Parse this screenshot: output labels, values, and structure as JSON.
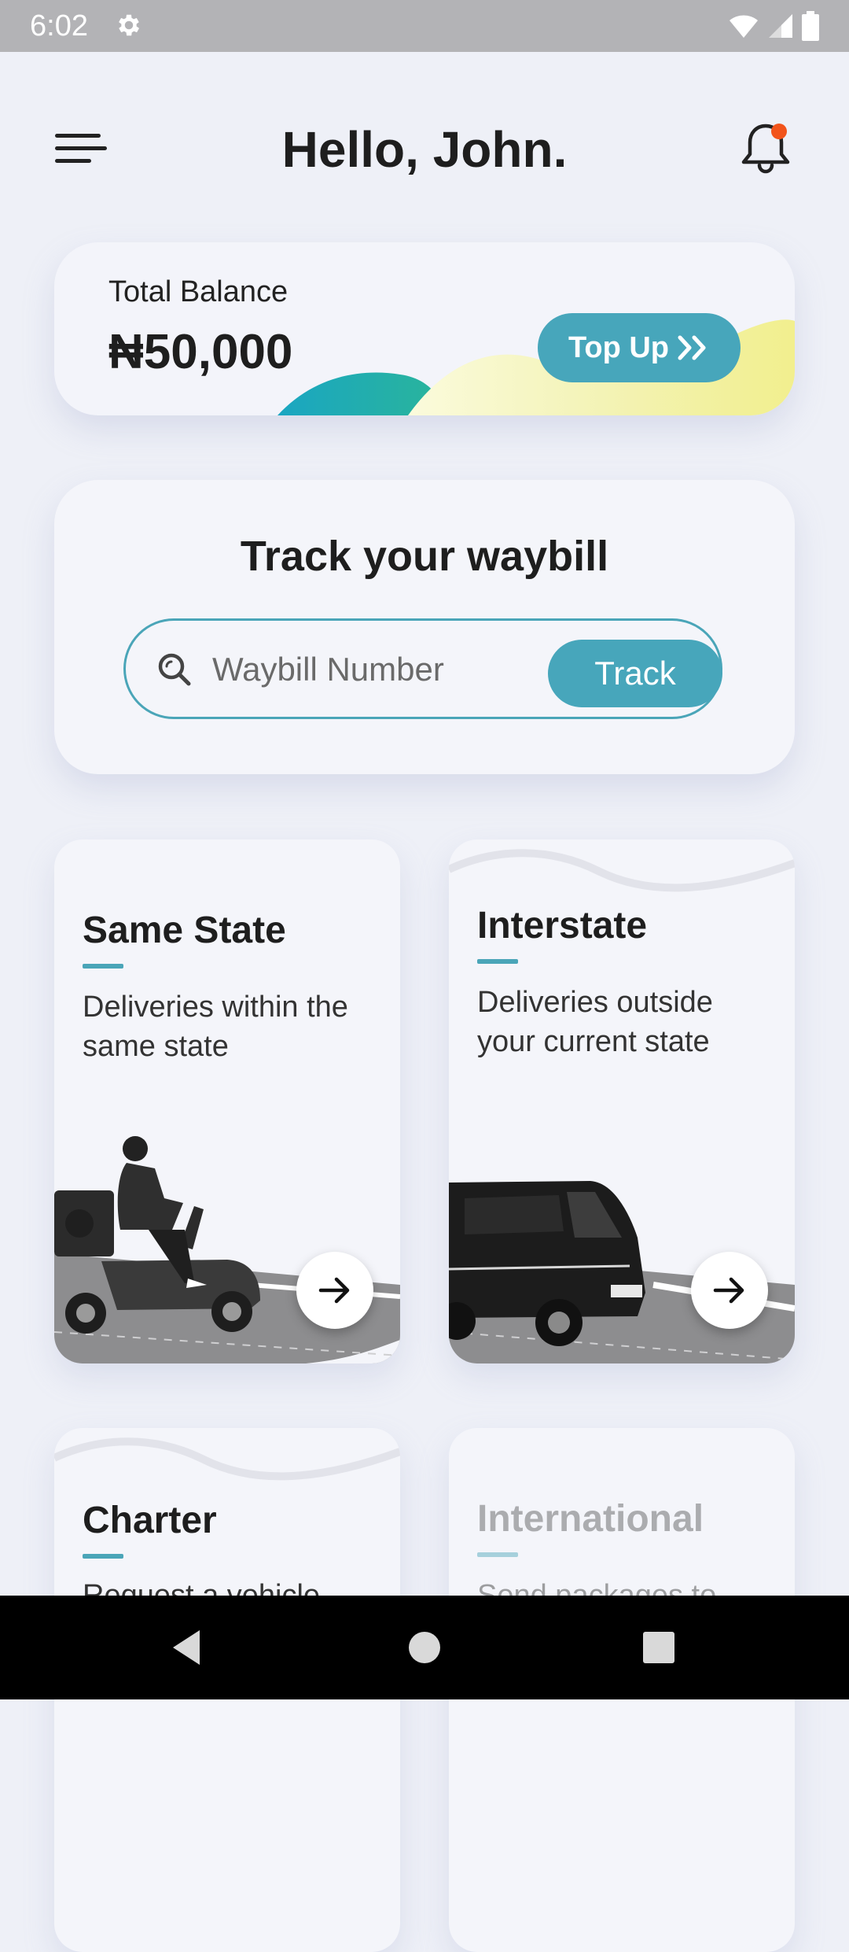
{
  "status_bar": {
    "time": "6:02"
  },
  "header": {
    "greeting": "Hello, John.",
    "has_notification": true
  },
  "balance": {
    "label": "Total Balance",
    "amount": "₦50,000",
    "topup_label": "Top Up"
  },
  "track": {
    "title": "Track your waybill",
    "placeholder": "Waybill Number",
    "button_label": "Track"
  },
  "services": [
    {
      "title": "Same State",
      "description": "Deliveries within the same state",
      "illustration": "scooter-rider"
    },
    {
      "title": "Interstate",
      "description": "Deliveries outside your current state",
      "illustration": "van"
    },
    {
      "title": "Charter",
      "description": "Request a vehicle"
    },
    {
      "title": "International",
      "description": "Send packages to",
      "disabled": true
    }
  ],
  "colors": {
    "accent": "#47a6bb",
    "background": "#eef0f7",
    "card": "#f4f5fa",
    "notification_dot": "#f2541b"
  },
  "icons": {
    "menu": "menu-icon",
    "bell": "bell-icon",
    "search": "search-icon",
    "arrow": "arrow-right-icon",
    "topup": "double-chevron-right-icon"
  }
}
